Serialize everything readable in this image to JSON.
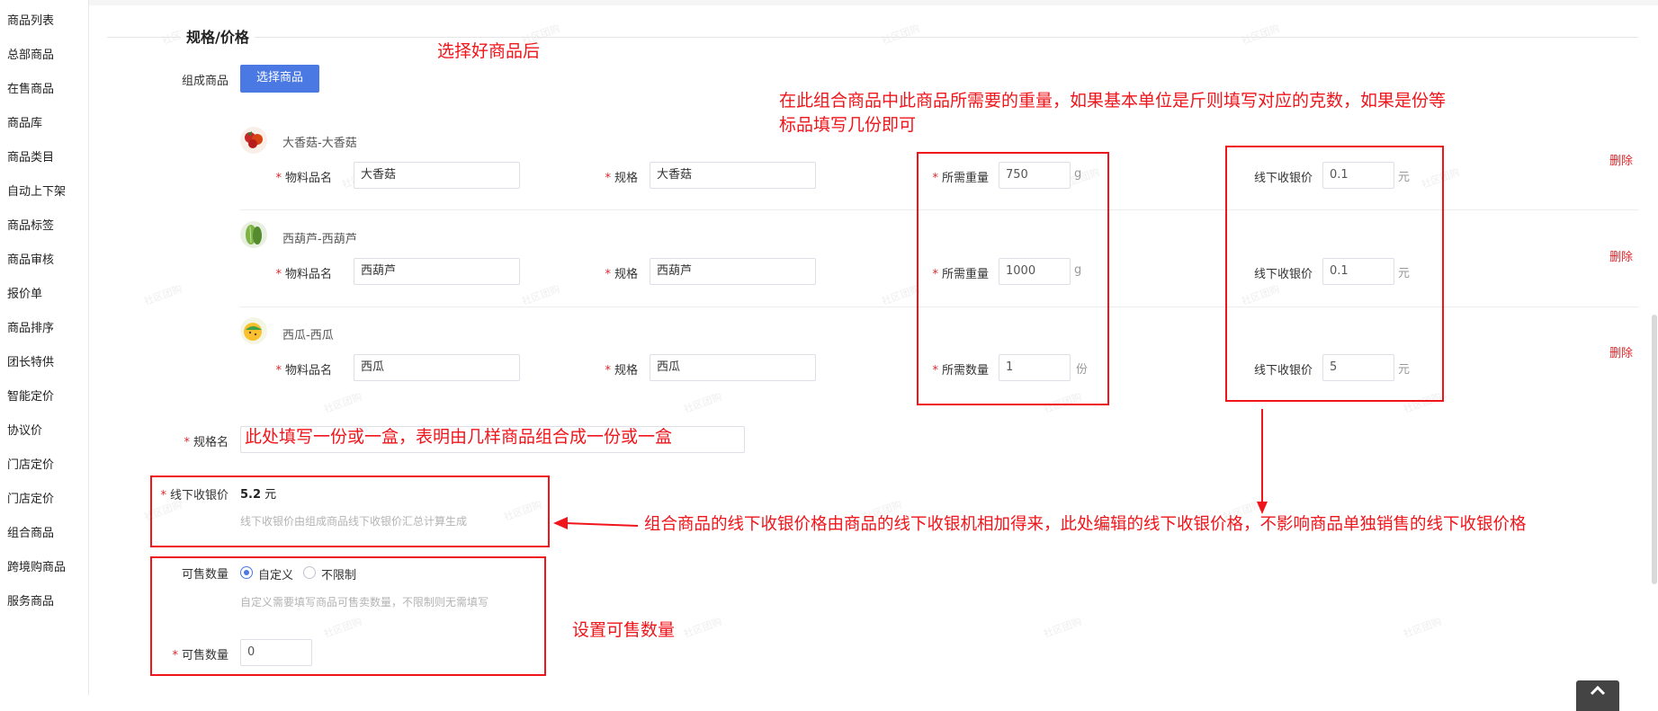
{
  "sidebar": {
    "items": [
      "商品列表",
      "总部商品",
      "在售商品",
      "商品库",
      "商品类目",
      "自动上下架",
      "商品标签",
      "商品审核",
      "报价单",
      "商品排序",
      "团长特供",
      "智能定价",
      "协议价",
      "门店定价",
      "门店定价",
      "组合商品",
      "跨境购商品",
      "服务商品"
    ]
  },
  "section": {
    "title": "规格/价格"
  },
  "compose": {
    "label": "组成商品",
    "select_button": "选择商品"
  },
  "labels": {
    "material_name": "物料品名",
    "spec": "规格",
    "required_weight": "所需重量",
    "required_qty": "所需数量",
    "offline_price": "线下收银价",
    "delete": "删除",
    "currency": "元"
  },
  "products": [
    {
      "title": "大香菇-大香菇",
      "material": "大香菇",
      "spec": "大香菇",
      "need_label": "所需重量",
      "need_value": "750",
      "need_unit": "g",
      "price": "0.1"
    },
    {
      "title": "西葫芦-西葫芦",
      "material": "西葫芦",
      "spec": "西葫芦",
      "need_label": "所需重量",
      "need_value": "1000",
      "need_unit": "g",
      "price": "0.1"
    },
    {
      "title": "西瓜-西瓜",
      "material": "西瓜",
      "spec": "西瓜",
      "need_label": "所需数量",
      "need_value": "1",
      "need_unit": "份",
      "price": "5"
    }
  ],
  "spec_name": {
    "label": "规格名",
    "value": ""
  },
  "offline_total": {
    "label": "线下收银价",
    "value": "5.2",
    "unit": "元",
    "hint": "线下收银价由组成商品线下收银价汇总计算生成"
  },
  "sellable": {
    "label": "可售数量",
    "options": [
      "自定义",
      "不限制"
    ],
    "selected": "自定义",
    "hint": "自定义需要填写商品可售卖数量，不限制则无需填写",
    "qty_label": "可售数量",
    "qty_value": "0"
  },
  "annotations": {
    "after_select": "选择好商品后",
    "weight_note_line1": "在此组合商品中此商品所需要的重量，如果基本单位是斤则填写对应的克数，如果是份等",
    "weight_note_line2": "标品填写几份即可",
    "spec_note": "此处填写一份或一盒，表明由几样商品组合成一份或一盒",
    "price_note": "组合商品的线下收银价格由商品的线下收银机相加得来，此处编辑的线下收银价格，不影响商品单独销售的线下收银价格",
    "qty_note": "设置可售数量"
  },
  "watermark": "社区团购",
  "colors": {
    "primary": "#4a79e3",
    "annotation": "#f0151b",
    "required": "#e0262a"
  }
}
